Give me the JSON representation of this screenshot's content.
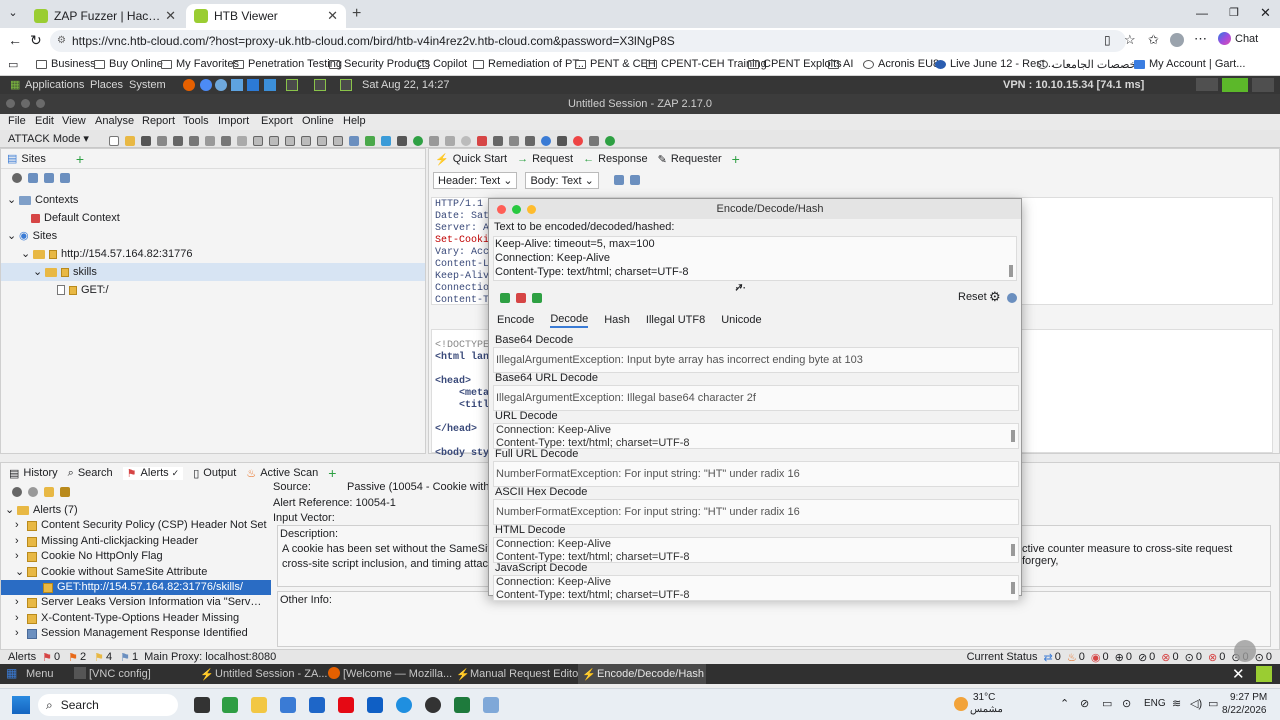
{
  "browser": {
    "tabs": [
      {
        "title": "ZAP Fuzzer | Hack The Box Academ",
        "active": false
      },
      {
        "title": "HTB Viewer",
        "active": true
      }
    ],
    "url": "https://vnc.htb-cloud.com/?host=proxy-uk.htb-cloud.com/bird/htb-v4in4rez2v.htb-cloud.com&password=X3lNgP8S",
    "chat_label": "Chat",
    "bookmarks": [
      "Business",
      "Buy Online",
      "My Favorites",
      "Penetration Testing",
      "Security Products",
      "Copilot",
      "Remediation of PT...",
      "PENT & CEH",
      "CPENT-CEH Training",
      "CPENT Exploits",
      "AI",
      "Acronis EU8",
      "Live June 12 - Rest...",
      "تخصصات الجامعات",
      "My Account | Gart..."
    ]
  },
  "desktop": {
    "applications": "Applications",
    "places": "Places",
    "system": "System",
    "datetime": "Sat Aug 22, 14:27",
    "vpn": "VPN : 10.10.15.34 [74.1 ms]"
  },
  "zap": {
    "window_title": "Untitled Session - ZAP 2.17.0",
    "menu": [
      "File",
      "Edit",
      "View",
      "Analyse",
      "Report",
      "Tools",
      "Import",
      "Export",
      "Online",
      "Help"
    ],
    "mode": "ATTACK Mode",
    "sites_tab": "Sites",
    "sites_tree": {
      "contexts": "Contexts",
      "default_context": "Default Context",
      "sites": "Sites",
      "host": "http://154.57.164.82:31776",
      "skills": "skills",
      "get": "GET:/"
    },
    "work_tabs": [
      "Quick Start",
      "Request",
      "Response",
      "Requester"
    ],
    "header_select": "Header: Text",
    "body_select": "Body: Text",
    "response_header_lines": [
      "HTTP/1.1 2",
      "Date: Sat",
      "Server: Ap",
      "Set-Cookie",
      "Vary: Acce",
      "Content-Le",
      "Keep-Alive",
      "Connection",
      "Content-Ty"
    ],
    "response_body_lines": [
      "<!DOCTYPE",
      "<html lang",
      "",
      "<head>",
      "    <meta",
      "    <title",
      "",
      "</head>",
      "",
      "<body sty"
    ],
    "bottom_tabs": [
      "History",
      "Search",
      "Alerts (7)",
      "Output",
      "Active Scan"
    ],
    "alerts_tab": "Alerts",
    "alerts_root": "Alerts (7)",
    "alerts": [
      "Content Security Policy (CSP) Header Not Set",
      "Missing Anti-clickjacking Header",
      "Cookie No HttpOnly Flag",
      "Cookie without SameSite Attribute",
      "GET:http://154.57.164.82:31776/skills/",
      "Server Leaks Version Information via \"Server\" HT",
      "X-Content-Type-Options Header Missing",
      "Session Management Response Identified"
    ],
    "alert_detail": {
      "source_label": "Source:",
      "source_value": "Passive (10054 - Cookie without",
      "reference": "Alert Reference: 10054-1",
      "input_vector": "Input Vector:",
      "description_label": "Description:",
      "description_text": "A cookie has been set without the SameSite at",
      "description_text2": "cross-site script inclusion, and timing attacks.",
      "description_right": "ctive counter measure to cross-site request forgery,",
      "other_info": "Other Info:"
    },
    "status": {
      "alerts": "Alerts",
      "counts": [
        "0",
        "2",
        "4",
        "1"
      ],
      "proxy": "Main Proxy: localhost:8080",
      "current_status": "Current Status",
      "scan_counts": [
        "0",
        "0",
        "0",
        "0",
        "0",
        "0",
        "0",
        "0",
        "0",
        "0"
      ]
    }
  },
  "dialog": {
    "title": "Encode/Decode/Hash",
    "input_label": "Text to be encoded/decoded/hashed:",
    "input_lines": [
      "Keep-Alive: timeout=5, max=100",
      "Connection: Keep-Alive",
      "Content-Type: text/html; charset=UTF-8"
    ],
    "reset": "Reset",
    "tabs": [
      "Encode",
      "Decode",
      "Hash",
      "Illegal UTF8",
      "Unicode"
    ],
    "active_tab": "Decode",
    "results": [
      {
        "name": "Base64 Decode",
        "lines": [
          "IllegalArgumentException: Input byte array has incorrect ending byte at 103"
        ]
      },
      {
        "name": "Base64 URL Decode",
        "lines": [
          "IllegalArgumentException: Illegal base64 character 2f"
        ]
      },
      {
        "name": "URL Decode",
        "lines": [
          "Connection: Keep-Alive",
          "Content-Type: text/html; charset=UTF-8"
        ]
      },
      {
        "name": "Full URL Decode",
        "lines": [
          "NumberFormatException: For input string: \"HT\" under radix 16"
        ]
      },
      {
        "name": "ASCII Hex Decode",
        "lines": [
          "NumberFormatException: For input string: \"HT\" under radix 16"
        ]
      },
      {
        "name": "HTML Decode",
        "lines": [
          "Connection: Keep-Alive",
          "Content-Type: text/html; charset=UTF-8"
        ]
      },
      {
        "name": "JavaScript Decode",
        "lines": [
          "Connection: Keep-Alive",
          "Content-Type: text/html; charset=UTF-8"
        ]
      }
    ]
  },
  "vnc_taskbar": [
    "Menu",
    "[VNC config]",
    "Untitled Session - ZA...",
    "[Welcome — Mozilla...",
    "Manual Request Editor",
    "Encode/Decode/Hash"
  ],
  "windows_taskbar": {
    "search": "Search",
    "weather_temp": "31°C",
    "weather_desc": "مشمس",
    "lang": "ENG",
    "time": "9:27 PM",
    "date": "8/22/2026"
  },
  "colors": {
    "zap_accent": "#e8b844",
    "set_cookie": "#c00000",
    "tab_active": "#ffffff"
  }
}
